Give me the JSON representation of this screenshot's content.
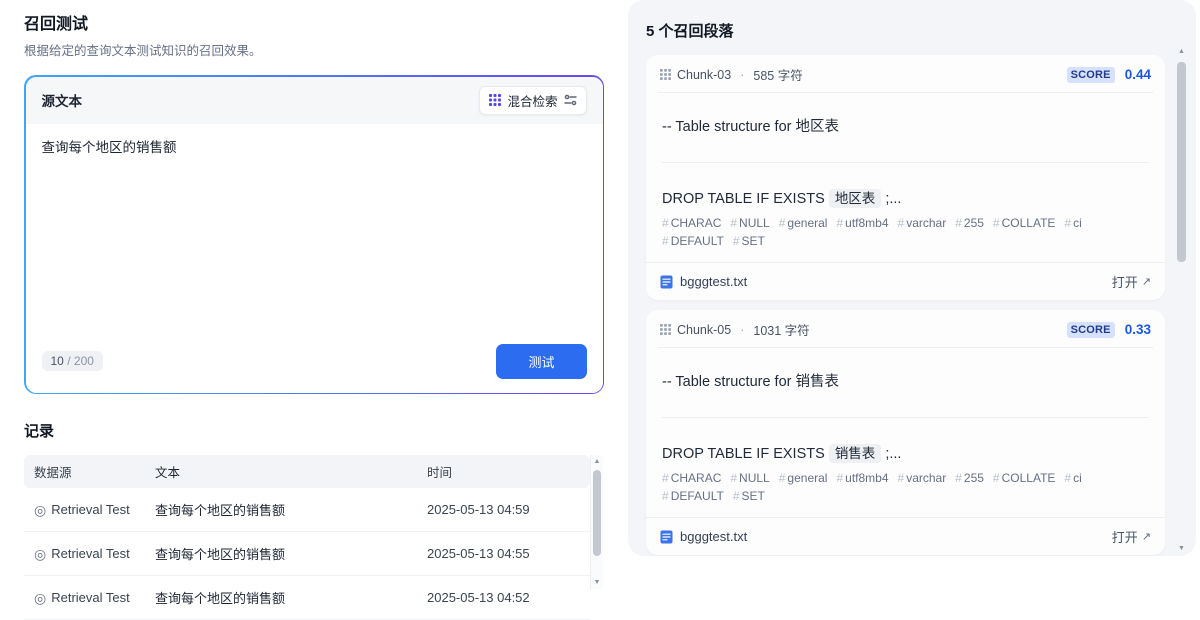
{
  "left": {
    "title": "召回测试",
    "subtitle": "根据给定的查询文本测试知识的召回效果。",
    "source_box": {
      "label": "源文本",
      "mode_button_label": "混合检索",
      "query_text": "查询每个地区的销售额",
      "counter": {
        "value": "10",
        "sep": "/",
        "max": "200"
      },
      "submit_label": "测试"
    },
    "records": {
      "title": "记录",
      "columns": {
        "source": "数据源",
        "text": "文本",
        "time": "时间"
      },
      "source_icon": "◎",
      "rows": [
        {
          "source": "Retrieval Test",
          "text": "查询每个地区的销售额",
          "time": "2025-05-13 04:59"
        },
        {
          "source": "Retrieval Test",
          "text": "查询每个地区的销售额",
          "time": "2025-05-13 04:55"
        },
        {
          "source": "Retrieval Test",
          "text": "查询每个地区的销售额",
          "time": "2025-05-13 04:52"
        }
      ]
    }
  },
  "right": {
    "title": "5 个召回段落",
    "score_label": "SCORE",
    "open_label": "打开",
    "open_icon": "↗",
    "dot": "·",
    "hash_prefix": "#",
    "chunks": [
      {
        "id": "Chunk-03",
        "chars": "585 字符",
        "score": "0.44",
        "line1": "-- Table structure for 地区表",
        "line2_prefix": "DROP TABLE IF EXISTS",
        "line2_chip": "地区表",
        "line2_suffix": ";...",
        "tags": [
          "CHARAC",
          "NULL",
          "general",
          "utf8mb4",
          "varchar",
          "255",
          "COLLATE",
          "ci",
          "DEFAULT",
          "SET"
        ],
        "file": "bgggtest.txt"
      },
      {
        "id": "Chunk-05",
        "chars": "1031 字符",
        "score": "0.33",
        "line1": "-- Table structure for 销售表",
        "line2_prefix": "DROP TABLE IF EXISTS",
        "line2_chip": "销售表",
        "line2_suffix": ";...",
        "tags": [
          "CHARAC",
          "NULL",
          "general",
          "utf8mb4",
          "varchar",
          "255",
          "COLLATE",
          "ci",
          "DEFAULT",
          "SET"
        ],
        "file": "bgggtest.txt"
      }
    ]
  }
}
